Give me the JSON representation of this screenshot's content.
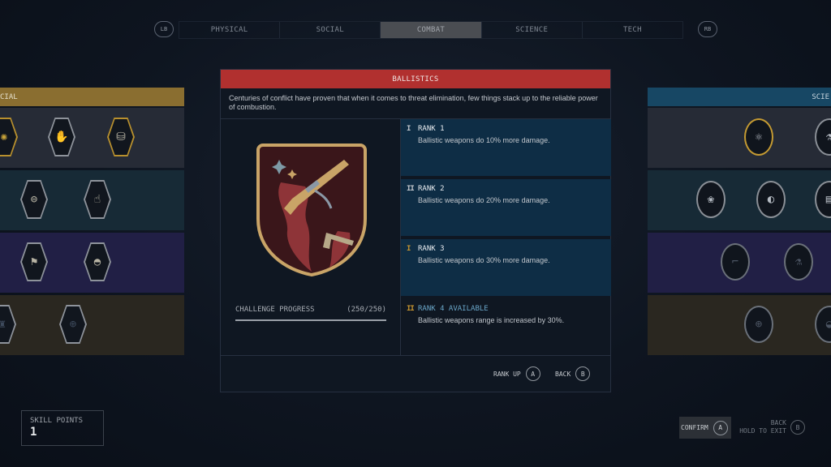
{
  "nav": {
    "left_bumper": "LB",
    "right_bumper": "RB",
    "tabs": [
      {
        "label": "PHYSICAL",
        "active": false
      },
      {
        "label": "SOCIAL",
        "active": false
      },
      {
        "label": "COMBAT",
        "active": true
      },
      {
        "label": "SCIENCE",
        "active": false
      },
      {
        "label": "TECH",
        "active": false
      }
    ]
  },
  "left_panel": {
    "header": "CIAL",
    "rows": [
      {
        "icons": [
          "gold-swirl-emblem-icon",
          "hands-icon",
          "treasure-chest-icon"
        ]
      },
      {
        "icons": [
          "trade-hands-icon",
          "pickpocket-hand-icon"
        ]
      },
      {
        "icons": [
          "explorer-flag-icon",
          "outpost-dome-icon"
        ]
      },
      {
        "icons": [
          "statue-icon",
          "globe-pedestal-icon"
        ]
      }
    ]
  },
  "right_panel": {
    "header": "SCIE",
    "rows": [
      {
        "icons": [
          "atom-icon",
          "lab-creature-icon"
        ]
      },
      {
        "icons": [
          "botany-icon",
          "astronaut-planet-icon",
          "document-icon"
        ]
      },
      {
        "icons": [
          "scanner-gun-icon",
          "chemistry-flask-icon"
        ]
      },
      {
        "icons": [
          "targeting-reticle-icon",
          "helmet-icon"
        ]
      }
    ]
  },
  "dialog": {
    "title": "BALLISTICS",
    "description": "Centuries of conflict have proven that when it comes to threat elimination, few things stack up to the reliable power of combustion.",
    "challenge": {
      "label": "CHALLENGE PROGRESS",
      "value": "(250/250)",
      "current": 250,
      "total": 250
    },
    "ranks": [
      {
        "marker": "I",
        "title": "RANK 1",
        "description": "Ballistic weapons do 10% more damage.",
        "state": "unlocked"
      },
      {
        "marker": "II",
        "title": "RANK 2",
        "description": "Ballistic weapons do 20% more damage.",
        "state": "unlocked"
      },
      {
        "marker": "I",
        "title": "RANK 3",
        "description": "Ballistic weapons do 30% more damage.",
        "state": "unlocked"
      },
      {
        "marker": "II",
        "title": "RANK 4 AVAILABLE",
        "description": "Ballistic weapons range is increased by 30%.",
        "state": "available"
      }
    ],
    "buttons": {
      "rank_up": "RANK UP",
      "rank_up_key": "A",
      "back": "BACK",
      "back_key": "B"
    }
  },
  "skill_points": {
    "label": "SKILL POINTS",
    "value": "1"
  },
  "footer": {
    "confirm": "CONFIRM",
    "confirm_key": "A",
    "back": "BACK",
    "hold_to_exit": "HOLD TO EXIT",
    "back_key": "B"
  },
  "colors": {
    "title_bar": "#b1302f",
    "rank_unlocked_bg": "#0e2d45",
    "rank_available_text": "#6aa6c8",
    "social_header": "#8a6e30",
    "science_header": "#174764",
    "gold_marker": "#c7952f"
  }
}
